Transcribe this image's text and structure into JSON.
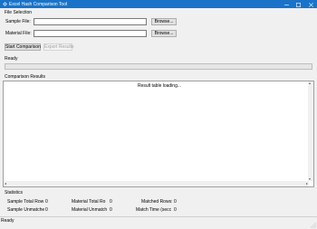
{
  "window": {
    "title": "Excel Hash Comparison Tool",
    "icon": "app-icon",
    "controls": [
      "minimize-icon",
      "maximize-icon",
      "close-icon"
    ]
  },
  "file_selection": {
    "group_label": "File Selection",
    "sample_label": "Sample File:",
    "sample_value": "",
    "material_label": "Material File:",
    "material_value": "",
    "browse_label": "Browse..."
  },
  "actions": {
    "start_label": "Start Comparison",
    "export_label": "Export Results"
  },
  "progress": {
    "status": "Ready",
    "value": 0
  },
  "results": {
    "group_label": "Comparison Results",
    "placeholder": "Result table loading..."
  },
  "statistics": {
    "group_label": "Statistics",
    "sample_total_label": "Sample Total Row",
    "sample_total_value": "0",
    "material_total_label": "Material Total Ro",
    "material_total_value": "0",
    "matched_label": "Matched Rows:",
    "matched_value": "0",
    "sample_unmatched_label": "Sample Unmatche",
    "sample_unmatched_value": "0",
    "material_unmatched_label": "Material Unmatch",
    "material_unmatched_value": "0",
    "match_time_label": "Match Time (secc",
    "match_time_value": "0"
  },
  "statusbar": {
    "text": "Ready"
  },
  "colors": {
    "titlebar": "#1a73c8",
    "window_bg": "#f0f0f0"
  }
}
